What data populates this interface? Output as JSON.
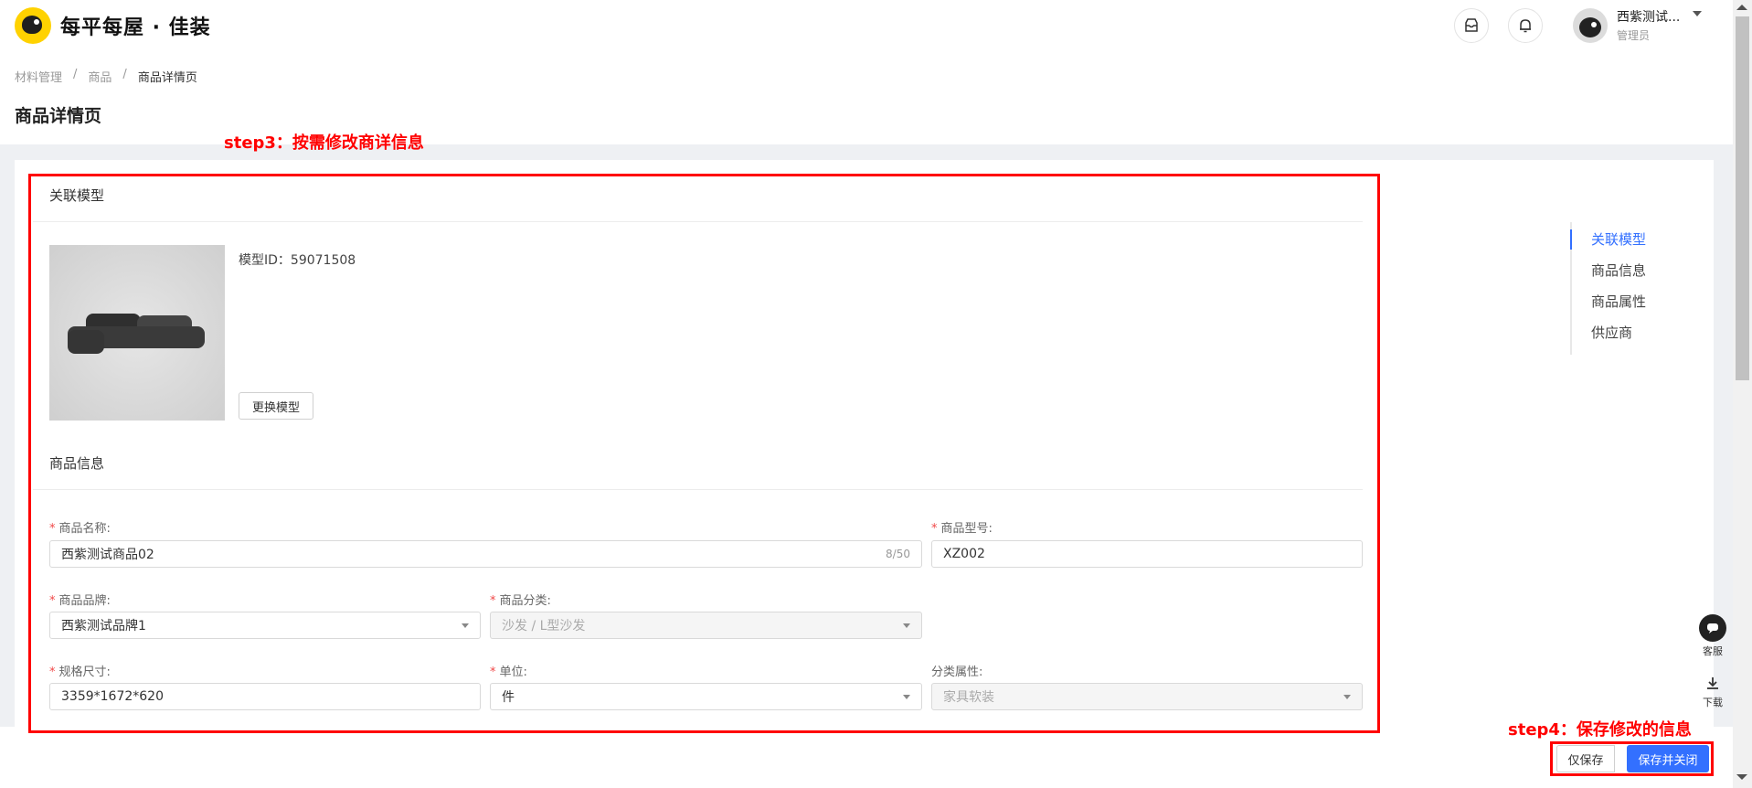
{
  "header": {
    "brand": "每平每屋 · 佳装",
    "user_name": "西紫测试...",
    "user_role": "管理员"
  },
  "breadcrumb": [
    "材料管理",
    "商品",
    "商品详情页"
  ],
  "page_title": "商品详情页",
  "sections": {
    "model": {
      "title": "关联模型",
      "model_id_text": "模型ID：59071508",
      "replace_button": "更换模型"
    },
    "product": {
      "title": "商品信息",
      "fields": {
        "name": {
          "label": "商品名称:",
          "value": "西紫测试商品02",
          "count": "8/50"
        },
        "model_no": {
          "label": "商品型号:",
          "value": "XZ002"
        },
        "brand": {
          "label": "商品品牌:",
          "value": "西紫测试品牌1"
        },
        "category": {
          "label": "商品分类:",
          "value": "沙发 / L型沙发"
        },
        "size": {
          "label": "规格尺寸:",
          "value": "3359*1672*620"
        },
        "unit": {
          "label": "单位:",
          "value": "件"
        },
        "attr": {
          "label": "分类属性:",
          "value": "家具软装"
        }
      }
    }
  },
  "anchor_nav": [
    "关联模型",
    "商品信息",
    "商品属性",
    "供应商"
  ],
  "annotations": {
    "step3": "step3：按需修改商详信息",
    "step4": "step4：保存修改的信息"
  },
  "footer": {
    "save_only": "仅保存",
    "save_close": "保存并关闭"
  },
  "float_tools": {
    "service": "客服",
    "download": "下载"
  },
  "colors": {
    "primary": "#3370ff",
    "annotation_red": "#ff0000",
    "required_star": "#f04848",
    "brand_yellow": "#ffd200"
  }
}
